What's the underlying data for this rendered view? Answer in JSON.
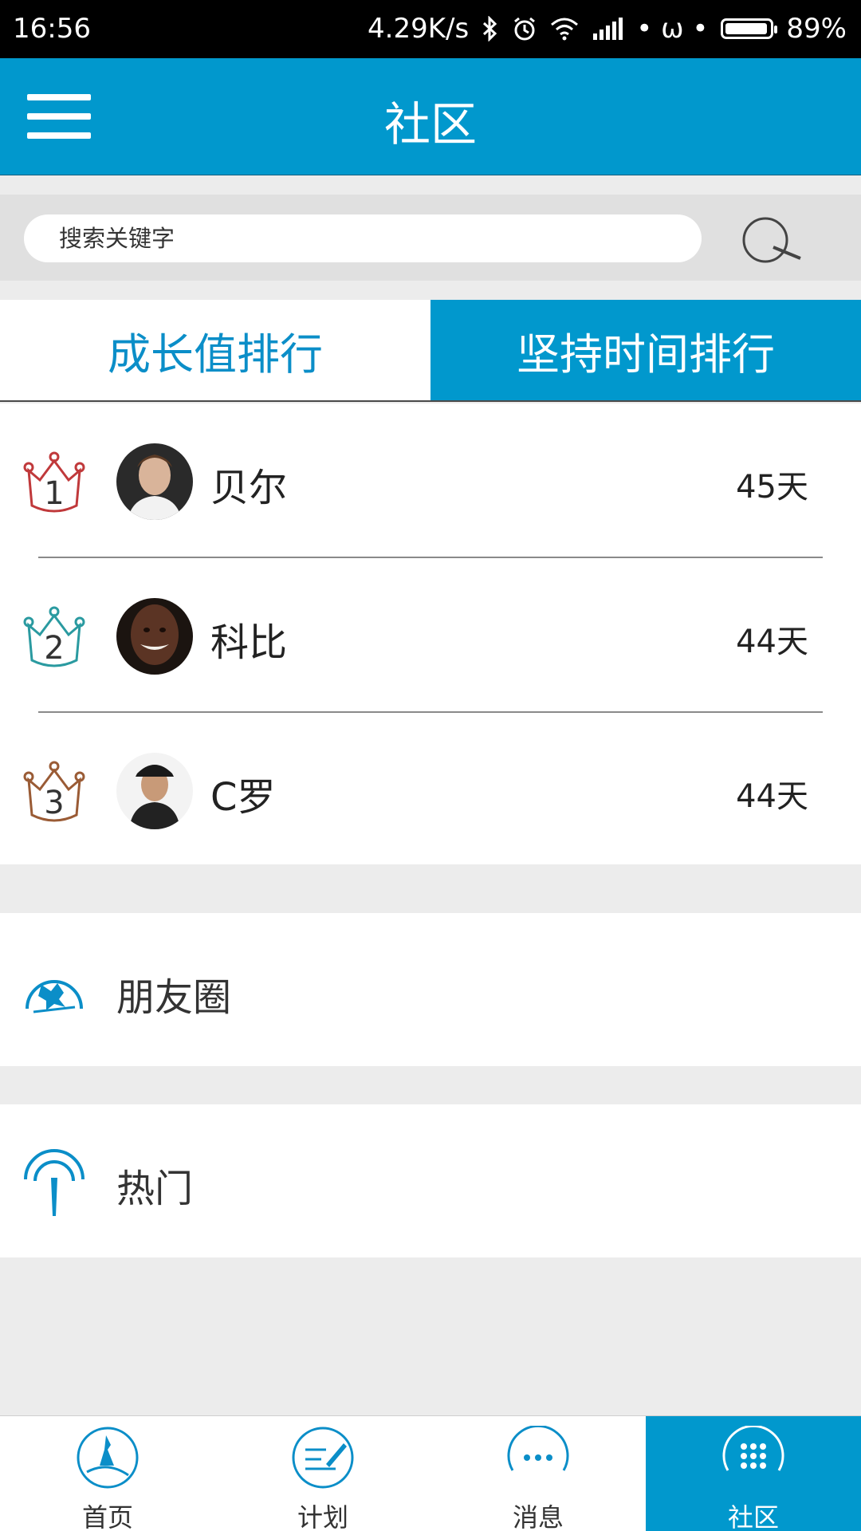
{
  "status_bar": {
    "time": "16:56",
    "network_speed": "4.29K/s",
    "extra": "• ω •",
    "battery": "89%",
    "icons": [
      "bluetooth-icon",
      "alarm-icon",
      "wifi-icon",
      "signal-icon",
      "battery-icon"
    ]
  },
  "header": {
    "title": "社区",
    "menu_icon": "hamburger-menu-icon"
  },
  "search": {
    "placeholder": "搜索关键字",
    "icon": "search-icon"
  },
  "tabs": [
    {
      "label": "成长值排行",
      "active": false
    },
    {
      "label": "坚持时间排行",
      "active": true
    }
  ],
  "ranking": [
    {
      "rank": "1",
      "name": "贝尔",
      "days": "45天",
      "crown_color": "#c0393b"
    },
    {
      "rank": "2",
      "name": "科比",
      "days": "44天",
      "crown_color": "#2a9aa0"
    },
    {
      "rank": "3",
      "name": "C罗",
      "days": "44天",
      "crown_color": "#9a5b35"
    }
  ],
  "entries": [
    {
      "label": "朋友圈",
      "icon": "friends-circle-icon"
    },
    {
      "label": "热门",
      "icon": "hot-antenna-icon"
    }
  ],
  "bottom_nav": [
    {
      "label": "首页",
      "icon": "home-icon",
      "active": false
    },
    {
      "label": "计划",
      "icon": "plan-icon",
      "active": false
    },
    {
      "label": "消息",
      "icon": "message-icon",
      "active": false
    },
    {
      "label": "社区",
      "icon": "community-icon",
      "active": true
    }
  ],
  "colors": {
    "primary": "#0198cd",
    "tab_text": "#0b8ec8",
    "background": "#ececec"
  }
}
